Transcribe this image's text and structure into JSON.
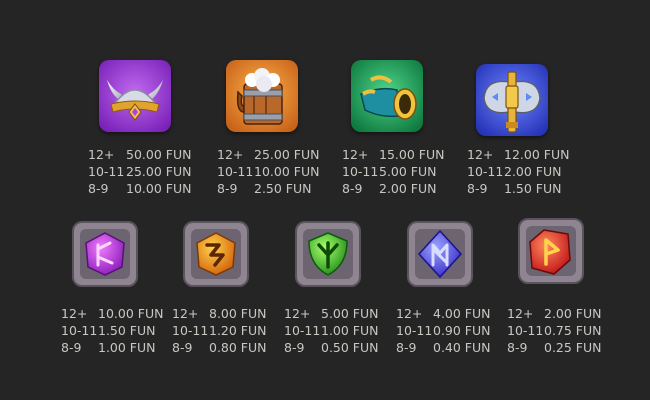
{
  "currency": "FUN",
  "high_symbols": [
    {
      "icon": "horned-helmet-icon",
      "tile_color": "#9b3fd1",
      "pays": [
        {
          "count": "12+",
          "payout": "50.00 FUN"
        },
        {
          "count": "10-11",
          "payout": "25.00 FUN"
        },
        {
          "count": "8-9",
          "payout": "10.00 FUN"
        }
      ]
    },
    {
      "icon": "ale-mug-icon",
      "tile_color": "#e58a25",
      "pays": [
        {
          "count": "12+",
          "payout": "25.00 FUN"
        },
        {
          "count": "10-11",
          "payout": "10.00 FUN"
        },
        {
          "count": "8-9",
          "payout": "2.50 FUN"
        }
      ]
    },
    {
      "icon": "war-horn-icon",
      "tile_color": "#1fa35a",
      "pays": [
        {
          "count": "12+",
          "payout": "15.00 FUN"
        },
        {
          "count": "10-11",
          "payout": "5.00 FUN"
        },
        {
          "count": "8-9",
          "payout": "2.00 FUN"
        }
      ]
    },
    {
      "icon": "battle-axe-icon",
      "tile_color": "#3d4fd4",
      "pays": [
        {
          "count": "12+",
          "payout": "12.00 FUN"
        },
        {
          "count": "10-11",
          "payout": "2.00 FUN"
        },
        {
          "count": "8-9",
          "payout": "1.50 FUN"
        }
      ]
    }
  ],
  "rune_symbols": [
    {
      "icon": "purple-rune-icon",
      "gem_color": "#c23be6",
      "pays": [
        {
          "count": "12+",
          "payout": "10.00 FUN"
        },
        {
          "count": "10-11",
          "payout": "1.50 FUN"
        },
        {
          "count": "8-9",
          "payout": "1.00 FUN"
        }
      ]
    },
    {
      "icon": "orange-rune-icon",
      "gem_color": "#f08a1a",
      "pays": [
        {
          "count": "12+",
          "payout": "8.00 FUN"
        },
        {
          "count": "10-11",
          "payout": "1.20 FUN"
        },
        {
          "count": "8-9",
          "payout": "0.80 FUN"
        }
      ]
    },
    {
      "icon": "green-rune-icon",
      "gem_color": "#3fcf2c",
      "pays": [
        {
          "count": "12+",
          "payout": "5.00 FUN"
        },
        {
          "count": "10-11",
          "payout": "1.00 FUN"
        },
        {
          "count": "8-9",
          "payout": "0.50 FUN"
        }
      ]
    },
    {
      "icon": "blue-rune-icon",
      "gem_color": "#5a5cf0",
      "pays": [
        {
          "count": "12+",
          "payout": "4.00 FUN"
        },
        {
          "count": "10-11",
          "payout": "0.90 FUN"
        },
        {
          "count": "8-9",
          "payout": "0.40 FUN"
        }
      ]
    },
    {
      "icon": "red-rune-icon",
      "gem_color": "#ee3a2a",
      "pays": [
        {
          "count": "12+",
          "payout": "2.00 FUN"
        },
        {
          "count": "10-11",
          "payout": "0.75 FUN"
        },
        {
          "count": "8-9",
          "payout": "0.25 FUN"
        }
      ]
    }
  ]
}
